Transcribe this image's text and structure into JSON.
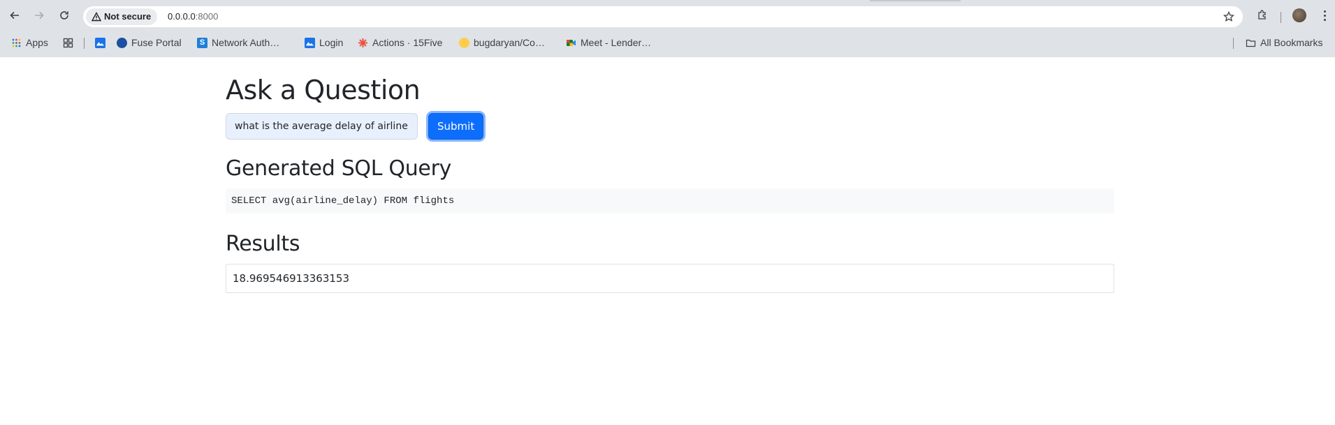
{
  "browser": {
    "security_chip": "Not secure",
    "url_host": "0.0.0.0",
    "url_port": ":8000",
    "bookmarks": [
      {
        "label": "Apps",
        "icon": "apps-grid-icon"
      },
      {
        "label": "",
        "icon": "tab-groups-icon"
      },
      {
        "label": "",
        "icon": "mountain-icon"
      },
      {
        "label": "Fuse Portal",
        "icon": "fuse-portal-icon"
      },
      {
        "label": "Network Auth…",
        "icon": "network-auth-icon"
      },
      {
        "label": "Login",
        "icon": "mountain-icon"
      },
      {
        "label": "Actions · 15Five",
        "icon": "15five-icon"
      },
      {
        "label": "bugdaryan/Co…",
        "icon": "hugging-face-icon"
      },
      {
        "label": "Meet - Lender…",
        "icon": "google-meet-icon"
      }
    ],
    "all_bookmarks": "All Bookmarks"
  },
  "page": {
    "title": "Ask a Question",
    "question_input_value": "what is the average delay of airline",
    "submit_label": "Submit",
    "sql_heading": "Generated SQL Query",
    "sql_query": "SELECT avg(airline_delay) FROM flights",
    "results_heading": "Results",
    "result_value": "18.969546913363153"
  },
  "colors": {
    "primary": "#0d6efd",
    "chrome_bg": "#dfe3e7",
    "input_autofill_bg": "#e8f0fe"
  }
}
